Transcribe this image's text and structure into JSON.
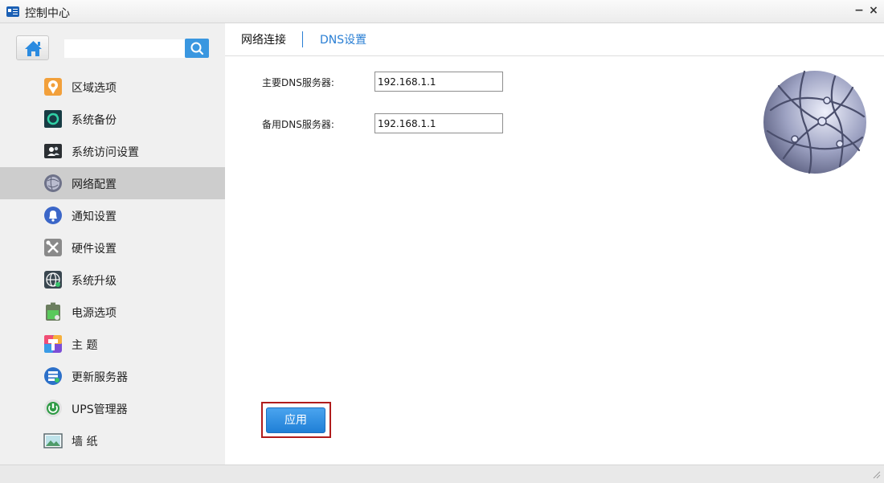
{
  "window": {
    "title": "控制中心",
    "minimize_glyph": "−",
    "close_glyph": "×"
  },
  "sidebar": {
    "search_placeholder": "",
    "items": [
      {
        "label": "区域选项",
        "icon": "location-pin-icon"
      },
      {
        "label": "系统备份",
        "icon": "backup-icon"
      },
      {
        "label": "系统访问设置",
        "icon": "users-icon"
      },
      {
        "label": "网络配置",
        "icon": "network-globe-icon",
        "active": true
      },
      {
        "label": "通知设置",
        "icon": "bell-icon"
      },
      {
        "label": "硬件设置",
        "icon": "tools-icon"
      },
      {
        "label": "系统升级",
        "icon": "globe-update-icon"
      },
      {
        "label": "电源选项",
        "icon": "battery-icon"
      },
      {
        "label": "主 题",
        "icon": "theme-palette-icon"
      },
      {
        "label": "更新服务器",
        "icon": "server-icon"
      },
      {
        "label": "UPS管理器",
        "icon": "ups-icon"
      },
      {
        "label": "墙 纸",
        "icon": "wallpaper-icon"
      }
    ]
  },
  "tabs": [
    {
      "label": "网络连接",
      "active": true
    },
    {
      "label": "DNS设置",
      "active": false
    }
  ],
  "form": {
    "primary_dns_label": "主要DNS服务器:",
    "primary_dns_value": "192.168.1.1",
    "secondary_dns_label": "备用DNS服务器:",
    "secondary_dns_value": "192.168.1.1",
    "apply_label": "应用"
  },
  "colors": {
    "accent": "#2a7fd4",
    "apply_button": "#3a93e6",
    "highlight_frame": "#b01c1c",
    "active_nav": "#cdcdcd"
  }
}
